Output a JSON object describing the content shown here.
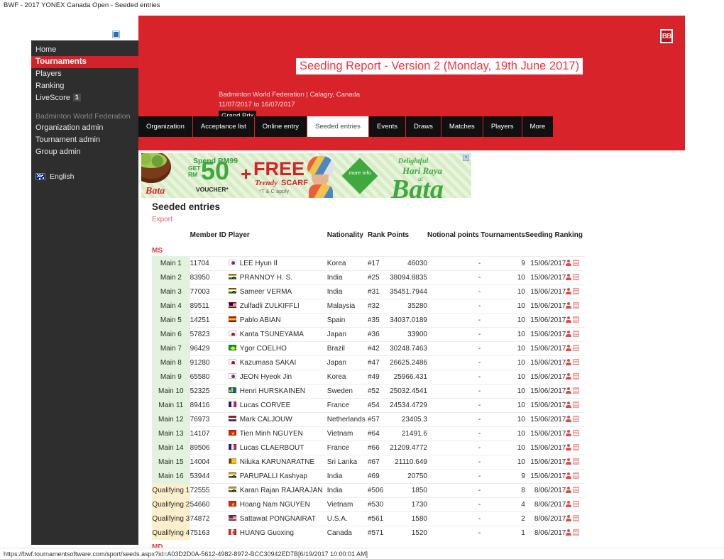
{
  "window": {
    "title": "BWF - 2017 YONEX Canada Open - Seeded entries"
  },
  "sidebar": {
    "logo_alt": "broken-image",
    "items": [
      {
        "label": "Home",
        "active": false
      },
      {
        "label": "Tournaments",
        "active": true
      },
      {
        "label": "Players",
        "active": false
      },
      {
        "label": "Ranking",
        "active": false
      },
      {
        "label": "LiveScore",
        "active": false,
        "badge": "1"
      }
    ],
    "group_title": "Badminton World Federation",
    "admin_items": [
      {
        "label": "Organization admin"
      },
      {
        "label": "Tournament admin"
      },
      {
        "label": "Group admin"
      }
    ],
    "language": {
      "label": "English",
      "flag": "australia-flag-icon"
    }
  },
  "hero": {
    "logo_text": "BB",
    "title": "Seeding Report - Version 2 (Monday, 19th June 2017)",
    "organisation": "Badminton World Federation | Calagry, Canada",
    "dates": "11/07/2017 to 16/07/2017",
    "category_chip": "Grand Prix",
    "tabs": [
      {
        "label": "Organization",
        "selected": false
      },
      {
        "label": "Acceptance list",
        "selected": false
      },
      {
        "label": "Online entry",
        "selected": false
      },
      {
        "label": "Seeded entries",
        "selected": true
      },
      {
        "label": "Events",
        "selected": false
      },
      {
        "label": "Draws",
        "selected": false
      },
      {
        "label": "Matches",
        "selected": false
      },
      {
        "label": "Players",
        "selected": false
      },
      {
        "label": "More",
        "selected": false
      }
    ]
  },
  "ad": {
    "brand_left": "Bata",
    "spend": "Spend RM99",
    "get": "GET",
    "rm": "RM",
    "amount": "50",
    "voucher": "VOUCHER*",
    "plus": "+",
    "free": "FREE",
    "trendy": "Trendy",
    "scarf": "SCARF",
    "terms": "*T & C apply",
    "more_info": "more info",
    "delightful": "Delightful",
    "hari_raya": "Hari Raya",
    "at": "at",
    "brand_big": "Bata",
    "close": "×"
  },
  "main": {
    "heading": "Seeded entries",
    "export_label": "Export",
    "columns": {
      "seed": "",
      "member_id": "Member ID",
      "player": "Player",
      "nationality": "Nationality",
      "rank": "Rank",
      "points": "Points",
      "notional_points": "Notional points",
      "tournaments": "Tournaments",
      "seeding_ranking": "Seeding Ranking"
    },
    "sections": [
      {
        "code": "MS",
        "rows": [
          {
            "seed": "Main 1",
            "type": "main",
            "member_id": "11704",
            "player": "LEE Hyun Il",
            "flag": "fl-kr",
            "nationality": "Korea",
            "rank": "#17",
            "points": "46030",
            "notional": "-",
            "tournaments": "9",
            "seeding_ranking": "15/06/2017"
          },
          {
            "seed": "Main 2",
            "type": "main",
            "member_id": "83950",
            "player": "PRANNOY H. S.",
            "flag": "fl-in",
            "nationality": "India",
            "rank": "#25",
            "points": "38094.8835",
            "notional": "-",
            "tournaments": "10",
            "seeding_ranking": "15/06/2017"
          },
          {
            "seed": "Main 3",
            "type": "main",
            "member_id": "77003",
            "player": "Sameer VERMA",
            "flag": "fl-in",
            "nationality": "India",
            "rank": "#31",
            "points": "35451.7944",
            "notional": "-",
            "tournaments": "10",
            "seeding_ranking": "15/06/2017"
          },
          {
            "seed": "Main 4",
            "type": "main",
            "member_id": "89511",
            "player": "Zulfadli ZULKIFFLI",
            "flag": "fl-my",
            "nationality": "Malaysia",
            "rank": "#32",
            "points": "35280",
            "notional": "-",
            "tournaments": "10",
            "seeding_ranking": "15/06/2017"
          },
          {
            "seed": "Main 5",
            "type": "main",
            "member_id": "14251",
            "player": "Pablo ABIAN",
            "flag": "fl-es",
            "nationality": "Spain",
            "rank": "#35",
            "points": "34037.0189",
            "notional": "-",
            "tournaments": "10",
            "seeding_ranking": "15/06/2017"
          },
          {
            "seed": "Main 6",
            "type": "main",
            "member_id": "57823",
            "player": "Kanta TSUNEYAMA",
            "flag": "fl-jp",
            "nationality": "Japan",
            "rank": "#36",
            "points": "33900",
            "notional": "-",
            "tournaments": "10",
            "seeding_ranking": "15/06/2017"
          },
          {
            "seed": "Main 7",
            "type": "main",
            "member_id": "96429",
            "player": "Ygor COELHO",
            "flag": "fl-br",
            "nationality": "Brazil",
            "rank": "#42",
            "points": "30248.7463",
            "notional": "-",
            "tournaments": "10",
            "seeding_ranking": "15/06/2017"
          },
          {
            "seed": "Main 8",
            "type": "main",
            "member_id": "91280",
            "player": "Kazumasa SAKAI",
            "flag": "fl-jp",
            "nationality": "Japan",
            "rank": "#47",
            "points": "26625.2486",
            "notional": "-",
            "tournaments": "10",
            "seeding_ranking": "15/06/2017"
          },
          {
            "seed": "Main 9",
            "type": "main",
            "member_id": "65580",
            "player": "JEON Hyeok Jin",
            "flag": "fl-kr",
            "nationality": "Korea",
            "rank": "#49",
            "points": "25966.431",
            "notional": "-",
            "tournaments": "10",
            "seeding_ranking": "15/06/2017"
          },
          {
            "seed": "Main 10",
            "type": "main",
            "member_id": "52325",
            "player": "Henri HURSKAINEN",
            "flag": "fl-se",
            "nationality": "Sweden",
            "rank": "#52",
            "points": "25032.4541",
            "notional": "-",
            "tournaments": "10",
            "seeding_ranking": "15/06/2017"
          },
          {
            "seed": "Main 11",
            "type": "main",
            "member_id": "89416",
            "player": "Lucas CORVEE",
            "flag": "fl-fr",
            "nationality": "France",
            "rank": "#54",
            "points": "24534.4729",
            "notional": "-",
            "tournaments": "10",
            "seeding_ranking": "15/06/2017"
          },
          {
            "seed": "Main 12",
            "type": "main",
            "member_id": "76973",
            "player": "Mark CALJOUW",
            "flag": "fl-nl",
            "nationality": "Netherlands",
            "rank": "#57",
            "points": "23405.3",
            "notional": "-",
            "tournaments": "10",
            "seeding_ranking": "15/06/2017"
          },
          {
            "seed": "Main 13",
            "type": "main",
            "member_id": "14107",
            "player": "Tien Minh NGUYEN",
            "flag": "fl-vn",
            "nationality": "Vietnam",
            "rank": "#64",
            "points": "21491.6",
            "notional": "-",
            "tournaments": "10",
            "seeding_ranking": "15/06/2017"
          },
          {
            "seed": "Main 14",
            "type": "main",
            "member_id": "89506",
            "player": "Lucas CLAERBOUT",
            "flag": "fl-fr",
            "nationality": "France",
            "rank": "#66",
            "points": "21209.4772",
            "notional": "-",
            "tournaments": "10",
            "seeding_ranking": "15/06/2017"
          },
          {
            "seed": "Main 15",
            "type": "main",
            "member_id": "14004",
            "player": "Niluka KARUNARATNE",
            "flag": "fl-lk",
            "nationality": "Sri Lanka",
            "rank": "#67",
            "points": "21110.649",
            "notional": "-",
            "tournaments": "10",
            "seeding_ranking": "15/06/2017"
          },
          {
            "seed": "Main 16",
            "type": "main",
            "member_id": "53944",
            "player": "PARUPALLI Kashyap",
            "flag": "fl-in",
            "nationality": "India",
            "rank": "#69",
            "points": "20750",
            "notional": "-",
            "tournaments": "9",
            "seeding_ranking": "15/06/2017"
          },
          {
            "seed": "Qualifying 1",
            "type": "qual",
            "member_id": "72555",
            "player": "Karan Rajan RAJARAJAN",
            "flag": "fl-in",
            "nationality": "India",
            "rank": "#506",
            "points": "1850",
            "notional": "-",
            "tournaments": "8",
            "seeding_ranking": "8/06/2017"
          },
          {
            "seed": "Qualifying 2",
            "type": "qual",
            "member_id": "54660",
            "player": "Hoang Nam NGUYEN",
            "flag": "fl-vn",
            "nationality": "Vietnam",
            "rank": "#530",
            "points": "1730",
            "notional": "-",
            "tournaments": "4",
            "seeding_ranking": "8/06/2017"
          },
          {
            "seed": "Qualifying 3",
            "type": "qual",
            "member_id": "74872",
            "player": "Sattawat PONGNAIRAT",
            "flag": "fl-us",
            "nationality": "U.S.A.",
            "rank": "#561",
            "points": "1580",
            "notional": "-",
            "tournaments": "2",
            "seeding_ranking": "8/06/2017"
          },
          {
            "seed": "Qualifying 4",
            "type": "qual",
            "member_id": "75163",
            "player": "HUANG Guoxing",
            "flag": "fl-ca",
            "nationality": "Canada",
            "rank": "#571",
            "points": "1520",
            "notional": "-",
            "tournaments": "1",
            "seeding_ranking": "8/06/2017"
          }
        ]
      },
      {
        "code": "MD",
        "rows": []
      }
    ]
  },
  "status_bar": {
    "url": "https://bwf.tournamentsoftware.com/sport/seeds.aspx?id=A03D2D0A-5612-4982-8972-BCC30942ED7B[6/19/2017 10:00:01 AM]"
  },
  "colors": {
    "brand_red": "#d8232a",
    "accent_red": "#ef3340",
    "sidebar_bg": "#2e2e2e",
    "main_seed_bg": "#e2f2dc",
    "qual_seed_bg": "#fbf0c9"
  }
}
